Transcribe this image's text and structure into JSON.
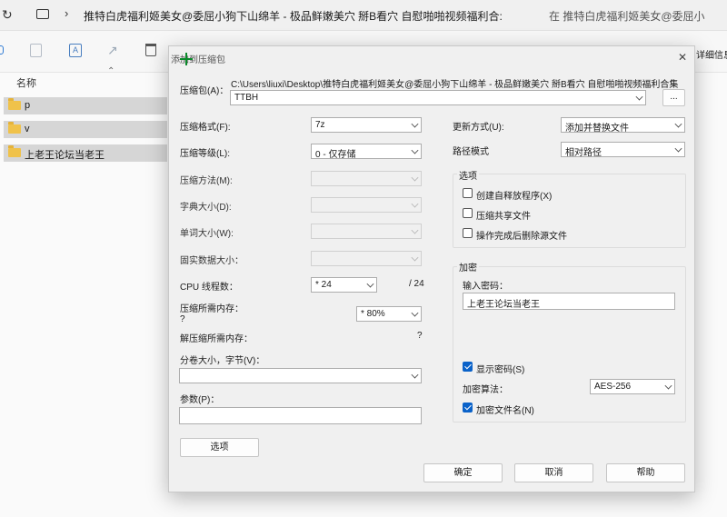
{
  "explorer": {
    "tab_title": "推特白虎福利姬美女@委屈小狗下山绵羊 - 极品鲜嫩美穴 掰B看穴 自慰啪啪视频福利合:",
    "search_placeholder": "在 推特白虎福利姬美女@委屈小",
    "column_name": "名称",
    "details_label": "详细信息",
    "folders": [
      "p",
      "v",
      "上老王论坛当老王"
    ]
  },
  "dialog": {
    "title": "添加到压缩包",
    "close_glyph": "✕",
    "archive_label": "压缩包(A)：",
    "archive_path": "C:\\Users\\liuxi\\Desktop\\推特白虎福利姬美女@委屈小狗下山绵羊 - 极品鲜嫩美穴 掰B看穴 自慰啪啪视频福利合集",
    "archive_name": "TTBH",
    "browse_label": "...",
    "left": {
      "format_label": "压缩格式(F):",
      "format_value": "7z",
      "level_label": "压缩等级(L):",
      "level_value": "0 - 仅存储",
      "method_label": "压缩方法(M):",
      "dict_label": "字典大小(D):",
      "word_label": "单词大小(W):",
      "solid_label": "固实数据大小：",
      "cpu_label": "CPU 线程数：",
      "cpu_value": "* 24",
      "cpu_total": "/ 24",
      "mem_label": "压缩所需内存：",
      "mem_q": "?",
      "mem_value": "* 80%",
      "decomp_label": "解压缩所需内存：",
      "decomp_q": "?",
      "split_label": "分卷大小，字节(V)：",
      "params_label": "参数(P)：",
      "options_button": "选项"
    },
    "right": {
      "update_label": "更新方式(U):",
      "update_value": "添加并替换文件",
      "path_label": "路径模式",
      "path_value": "相对路径",
      "options_title": "选项",
      "sfx_label": "创建自释放程序(X)",
      "shared_label": "压缩共享文件",
      "delete_label": "操作完成后删除源文件",
      "encrypt_title": "加密",
      "password_label": "输入密码：",
      "password_value": "上老王论坛当老王",
      "show_password_label": "显示密码(S)",
      "algo_label": "加密算法：",
      "algo_value": "AES-256",
      "encrypt_names_label": "加密文件名(N)"
    },
    "buttons": {
      "ok": "确定",
      "cancel": "取消",
      "help": "帮助"
    }
  }
}
